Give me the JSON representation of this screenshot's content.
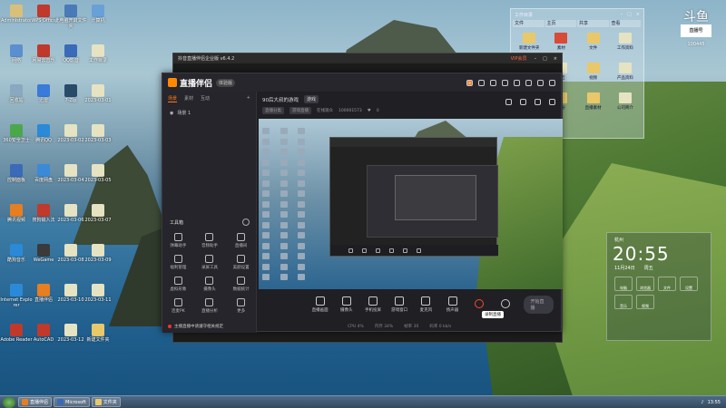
{
  "desktop": {
    "icons": [
      {
        "label": "Administrator",
        "color": "#d8c07a"
      },
      {
        "label": "WPS Office",
        "color": "#c0392b"
      },
      {
        "label": "此电脑开启文件夹",
        "color": "#4a7ab8"
      },
      {
        "label": "计算机",
        "color": "#6aa0d8"
      },
      {
        "label": "网络",
        "color": "#5b8fd0"
      },
      {
        "label": "网易云音乐",
        "color": "#c0392b"
      },
      {
        "label": "QQ影音",
        "color": "#3a6ab8"
      },
      {
        "label": "工作目录",
        "color": "#e6e3c2"
      },
      {
        "label": "回收站",
        "color": "#8aa8c0"
      },
      {
        "label": "迅雷",
        "color": "#3a7ad8"
      },
      {
        "label": "7-Zip",
        "color": "#2a4a6a"
      },
      {
        "label": "2023-03-01",
        "color": "#e6e3c2"
      },
      {
        "label": "360安全卫士",
        "color": "#4aa84a"
      },
      {
        "label": "腾讯QQ",
        "color": "#2a8ad8"
      },
      {
        "label": "2023-03-02",
        "color": "#e6e3c2"
      },
      {
        "label": "2023-03-03",
        "color": "#e6e3c2"
      },
      {
        "label": "控制面板",
        "color": "#3a6ab8"
      },
      {
        "label": "百度网盘",
        "color": "#3a8ad8"
      },
      {
        "label": "2023-03-04",
        "color": "#e6e3c2"
      },
      {
        "label": "2023-03-05",
        "color": "#e6e3c2"
      },
      {
        "label": "腾讯视频",
        "color": "#e67e22"
      },
      {
        "label": "搜狗输入法",
        "color": "#c0392b"
      },
      {
        "label": "2023-03-06",
        "color": "#e6e3c2"
      },
      {
        "label": "2023-03-07",
        "color": "#e6e3c2"
      },
      {
        "label": "酷狗音乐",
        "color": "#2a8ad8"
      },
      {
        "label": "WeGame",
        "color": "#3a3a3a"
      },
      {
        "label": "2023-03-08",
        "color": "#e6e3c2"
      },
      {
        "label": "2023-03-09",
        "color": "#e6e3c2"
      },
      {
        "label": "Internet Explorer",
        "color": "#2a8ad8"
      },
      {
        "label": "直播伴侣",
        "color": "#e67e22"
      },
      {
        "label": "2023-03-10",
        "color": "#e6e3c2"
      },
      {
        "label": "2023-03-11",
        "color": "#e6e3c2"
      },
      {
        "label": "Adobe Reader",
        "color": "#c0392b"
      },
      {
        "label": "AutoCAD",
        "color": "#c0392b"
      },
      {
        "label": "2023-03-12",
        "color": "#e6e3c2"
      },
      {
        "label": "新建文件夹",
        "color": "#e9c86a"
      }
    ]
  },
  "taskbar": {
    "items": [
      {
        "label": "直播伴侣",
        "color": "#e67e22"
      },
      {
        "label": "Microsoft",
        "color": "#3a6ab8"
      },
      {
        "label": "文件夹",
        "color": "#e9c86a"
      }
    ],
    "time": "13:55"
  },
  "folder_window": {
    "title": "工作目录",
    "tabs": [
      "文件",
      "主页",
      "共享",
      "查看"
    ],
    "items": [
      {
        "label": "新建文件夹",
        "type": "folder"
      },
      {
        "label": "素材",
        "type": "pdf"
      },
      {
        "label": "文件",
        "type": "folder"
      },
      {
        "label": "工作资料",
        "type": "doc"
      },
      {
        "label": "图片",
        "type": "folder"
      },
      {
        "label": "报告",
        "type": "doc"
      },
      {
        "label": "视频",
        "type": "folder"
      },
      {
        "label": "产品资料",
        "type": "doc"
      },
      {
        "label": "教程",
        "type": "doc"
      },
      {
        "label": "备份",
        "type": "folder"
      },
      {
        "label": "直播素材",
        "type": "folder"
      },
      {
        "label": "公司简介",
        "type": "doc"
      }
    ]
  },
  "logo_overlay": {
    "char": "斗鱼",
    "tag": "直播号",
    "num": "100445"
  },
  "clock_widget": {
    "location": "杭州",
    "time": "20:55",
    "date": "11月24日",
    "weekday": "周五",
    "shortcuts": [
      "电脑",
      "浏览器",
      "文件",
      "设置",
      "音乐",
      "视频"
    ]
  },
  "back_window": {
    "title": "抖音直播伴侣企业版 v6.4.2",
    "vip": "VIP会员"
  },
  "app": {
    "name": "直播伴侣",
    "badge": "体验版",
    "sidebar_tabs": [
      "场景",
      "素材",
      "互动"
    ],
    "scene_label": "场景 1",
    "tools_title": "工具箱",
    "tools": [
      {
        "label": "弹幕助手"
      },
      {
        "label": "音频助手"
      },
      {
        "label": "直播间"
      },
      {
        "label": "福利管理"
      },
      {
        "label": "录屏工具"
      },
      {
        "label": "美颜设置"
      },
      {
        "label": "虚拟形象"
      },
      {
        "label": "摄像头"
      },
      {
        "label": "数据统计"
      },
      {
        "label": "连麦PK"
      },
      {
        "label": "直播分析"
      },
      {
        "label": "更多"
      }
    ],
    "notice": "主播直播中请遵守相关规定",
    "room_title": "90后大叔的游戏",
    "room_tag": "游戏",
    "sub_tags": [
      "直播分类",
      "游戏直播"
    ],
    "viewers": "在线观众",
    "room_id": "100001573",
    "likes": "0",
    "controls": [
      {
        "label": "直播画面"
      },
      {
        "label": "摄像头"
      },
      {
        "label": "手机投屏"
      },
      {
        "label": "游戏窗口"
      },
      {
        "label": "麦克风"
      },
      {
        "label": "扬声器"
      }
    ],
    "start_label": "开始直播",
    "tooltip": "录制直播",
    "status": [
      "CPU 4%",
      "内存 34%",
      "帧率 30",
      "码率 0 kb/s"
    ]
  }
}
